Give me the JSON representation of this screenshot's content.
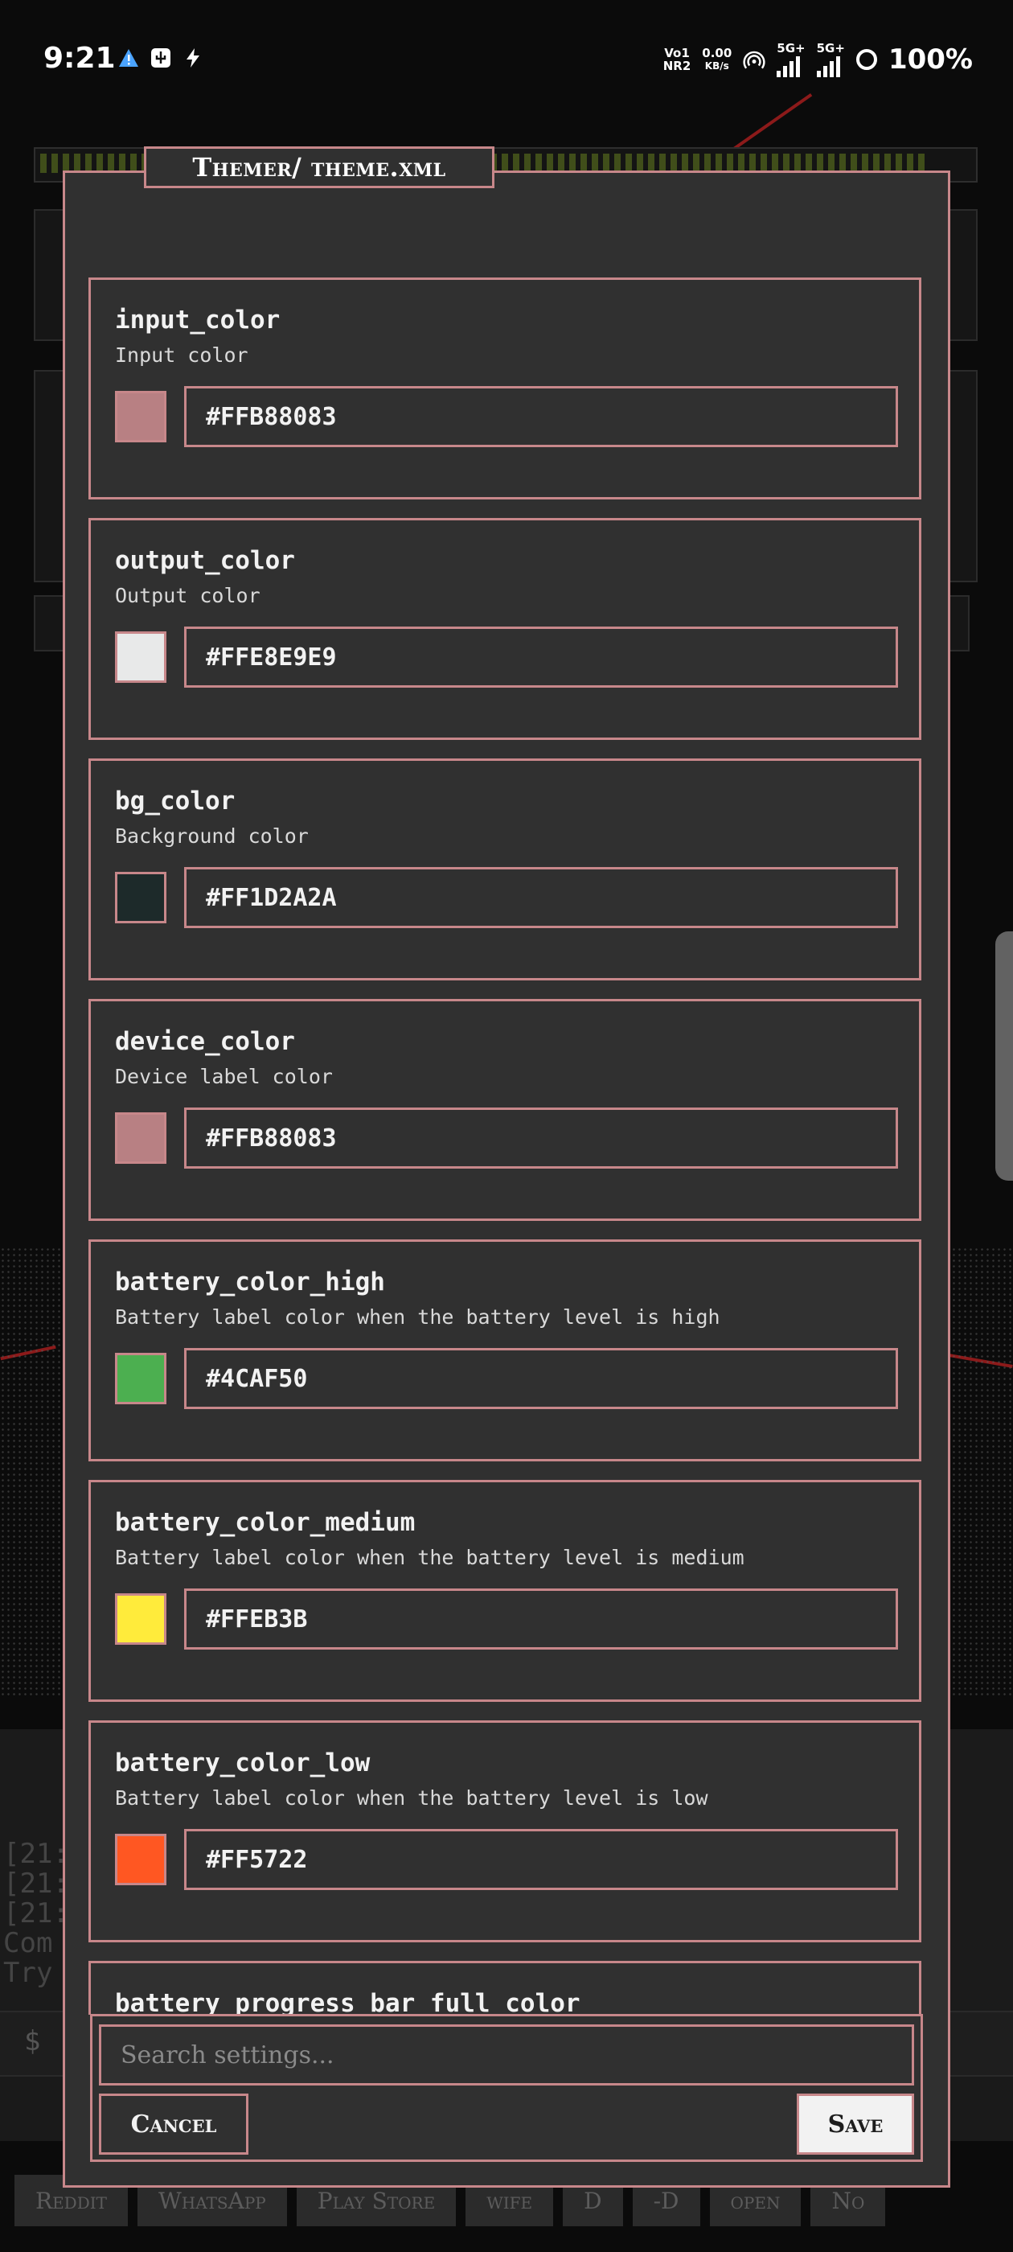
{
  "status_bar": {
    "time": "9:21",
    "left_icons": [
      "alert-icon",
      "usb-icon",
      "flash-icon"
    ],
    "volte_line1": "Vo1",
    "volte_line2": "NR2",
    "speed_line1": "0.00",
    "speed_line2": "KB/s",
    "sim1_label": "5G+",
    "sim2_label": "5G+",
    "battery": "100%"
  },
  "dialog": {
    "title": "Themer/ theme.xml",
    "settings": [
      {
        "key": "input_color",
        "description": "Input color",
        "value": "#FFB88083",
        "swatch": "#b88083"
      },
      {
        "key": "output_color",
        "description": "Output color",
        "value": "#FFE8E9E9",
        "swatch": "#e8e9e9"
      },
      {
        "key": "bg_color",
        "description": "Background color",
        "value": "#FF1D2A2A",
        "swatch": "#1d2a2a"
      },
      {
        "key": "device_color",
        "description": "Device label color",
        "value": "#FFB88083",
        "swatch": "#b88083"
      },
      {
        "key": "battery_color_high",
        "description": "Battery label color when the battery level is high",
        "value": "#4CAF50",
        "swatch": "#4caf50"
      },
      {
        "key": "battery_color_medium",
        "description": "Battery label color when the battery level is medium",
        "value": "#FFEB3B",
        "swatch": "#ffeb3b"
      },
      {
        "key": "battery_color_low",
        "description": "Battery label color when the battery level is low",
        "value": "#FF5722",
        "swatch": "#ff5722"
      },
      {
        "key": "battery_progress_bar_full_color",
        "description": "",
        "value": "",
        "swatch": ""
      }
    ],
    "search_placeholder": "Search settings...",
    "cancel_label": "Cancel",
    "save_label": "Save"
  },
  "background": {
    "shortcuts": [
      "Reddit",
      "WhatsApp",
      "Play Store",
      "wife",
      "D",
      "-D",
      "open",
      "No"
    ]
  },
  "colors": {
    "accent": "#c7878a",
    "dialog_bg": "#303030",
    "page_bg": "#0b0b0b"
  }
}
